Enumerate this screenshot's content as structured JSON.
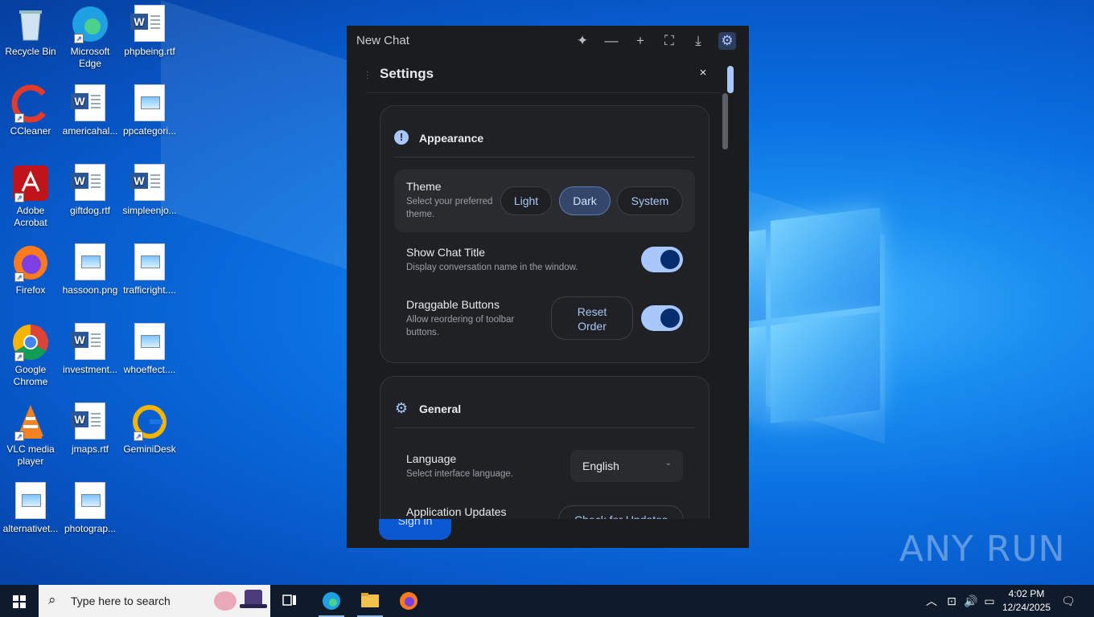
{
  "desktop": {
    "icons": [
      {
        "label": "Recycle Bin",
        "icon": "recycle-bin-icon"
      },
      {
        "label": "Microsoft Edge",
        "icon": "edge-icon"
      },
      {
        "label": "phpbeing.rtf",
        "icon": "word-doc-icon"
      },
      {
        "label": "CCleaner",
        "icon": "ccleaner-icon"
      },
      {
        "label": "americahal...",
        "icon": "word-doc-icon"
      },
      {
        "label": "ppcategori...",
        "icon": "image-file-icon"
      },
      {
        "label": "Adobe Acrobat",
        "icon": "acrobat-icon"
      },
      {
        "label": "giftdog.rtf",
        "icon": "word-doc-icon"
      },
      {
        "label": "simpleenjo...",
        "icon": "word-doc-icon"
      },
      {
        "label": "Firefox",
        "icon": "firefox-icon"
      },
      {
        "label": "hassoon.png",
        "icon": "image-file-icon"
      },
      {
        "label": "trafficright....",
        "icon": "image-file-icon"
      },
      {
        "label": "Google Chrome",
        "icon": "chrome-icon"
      },
      {
        "label": "investment...",
        "icon": "word-doc-icon"
      },
      {
        "label": "whoeffect....",
        "icon": "image-file-icon"
      },
      {
        "label": "VLC media player",
        "icon": "vlc-icon"
      },
      {
        "label": "jmaps.rtf",
        "icon": "word-doc-icon"
      },
      {
        "label": "GeminiDesk",
        "icon": "geminidesk-icon"
      },
      {
        "label": "alternativet...",
        "icon": "image-file-icon"
      },
      {
        "label": "photograp...",
        "icon": "image-file-icon"
      }
    ],
    "watermark": "ANY RUN"
  },
  "app": {
    "title": "New Chat",
    "toolbar": {
      "sparkle": "✦",
      "minimize": "—",
      "new": "+",
      "fullscreen": "⛶",
      "download": "⤓",
      "settings": "⚙"
    },
    "settings": {
      "title": "Settings",
      "close": "×",
      "appearance": {
        "heading": "Appearance",
        "theme": {
          "title": "Theme",
          "desc": "Select your preferred theme.",
          "options": [
            "Light",
            "Dark",
            "System"
          ],
          "selected": "Dark"
        },
        "show_chat_title": {
          "title": "Show Chat Title",
          "desc": "Display conversation name in the window.",
          "enabled": true
        },
        "draggable_buttons": {
          "title": "Draggable Buttons",
          "desc": "Allow reordering of toolbar buttons.",
          "reset_label": "Reset Order",
          "enabled": true
        }
      },
      "general": {
        "heading": "General",
        "language": {
          "title": "Language",
          "desc": "Select interface language.",
          "value": "English"
        },
        "updates": {
          "title": "Application Updates",
          "button": "Check for Updates"
        }
      }
    },
    "sign_in": "Sign in"
  },
  "taskbar": {
    "search_placeholder": "Type here to search",
    "clock_time": "4:02 PM",
    "clock_date": "12/24/2025"
  }
}
